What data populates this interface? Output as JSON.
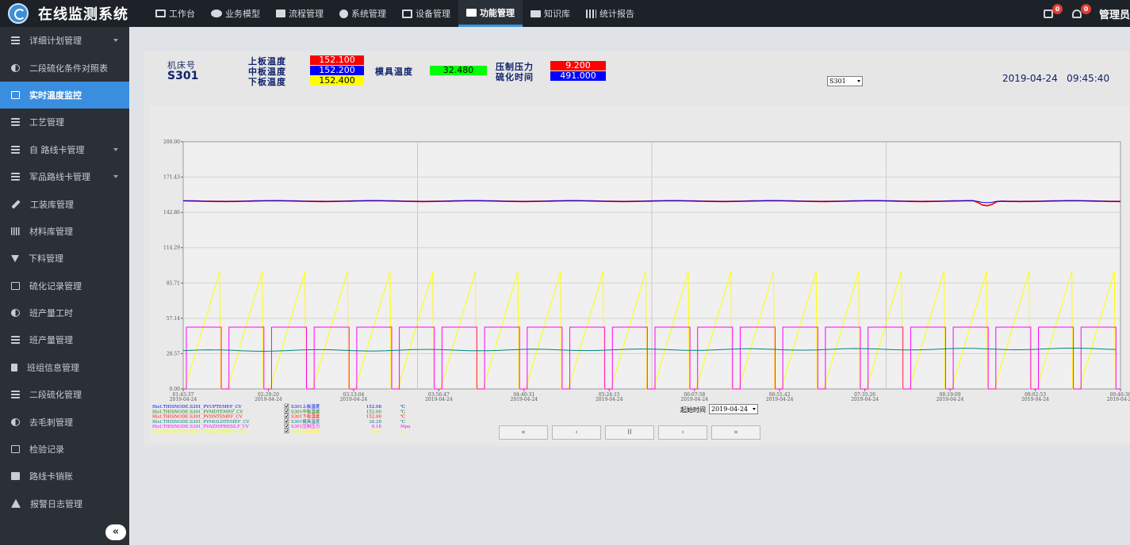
{
  "header": {
    "title": "在线监测系统",
    "nav": [
      {
        "label": "工作台",
        "icon": "monitor-icon"
      },
      {
        "label": "业务模型",
        "icon": "group-icon"
      },
      {
        "label": "流程管理",
        "icon": "sitemap-icon"
      },
      {
        "label": "系统管理",
        "icon": "gear-icon"
      },
      {
        "label": "设备管理",
        "icon": "device-icon"
      },
      {
        "label": "功能管理",
        "icon": "list-icon",
        "active": true
      },
      {
        "label": "知识库",
        "icon": "folder-icon"
      },
      {
        "label": "统计报告",
        "icon": "bar-chart-icon"
      }
    ],
    "task_badge": "0",
    "notice_badge": "0",
    "user": "管理员"
  },
  "sidebar": {
    "items": [
      {
        "label": "详细计划管理",
        "has_arrow": true
      },
      {
        "label": "二段硫化条件对照表"
      },
      {
        "label": "实时温度监控",
        "active": true
      },
      {
        "label": "工艺管理"
      },
      {
        "label": "自  路线卡管理",
        "has_arrow": true
      },
      {
        "label": "军品路线卡管理",
        "has_arrow": true
      },
      {
        "label": "工装库管理"
      },
      {
        "label": "材料库管理"
      },
      {
        "label": "下料管理"
      },
      {
        "label": "硫化记录管理"
      },
      {
        "label": "班产量工时"
      },
      {
        "label": "班产量管理"
      },
      {
        "label": "班组信息管理"
      },
      {
        "label": "二段硫化管理"
      },
      {
        "label": "去毛刺管理"
      },
      {
        "label": "检验记录"
      },
      {
        "label": "路线卡销账"
      },
      {
        "label": "报警日志管理"
      }
    ],
    "collapse_label": "«"
  },
  "monitor": {
    "machine_label": "机床号",
    "machine_id": "S301",
    "upper_temp_label": "上板温度",
    "upper_temp": "152.100",
    "middle_temp_label": "中板温度",
    "middle_temp": "152.200",
    "lower_temp_label": "下板温度",
    "lower_temp": "152.400",
    "mold_temp_label": "模具温度",
    "mold_temp": "32.480",
    "pressure_label": "压制压力",
    "pressure": "9.200",
    "cure_time_label": "硫化时间",
    "cure_time": "491.000",
    "machine_select": "S301",
    "datetime": "2019-04-24   09:45:40",
    "start_time_label": "起始时间",
    "start_date": "2019-04-24",
    "colors": {
      "upper": "#ff0000",
      "middle": "#0000ff",
      "lower": "#ffff00",
      "mold": "#00ff00",
      "pressure": "#ff0000",
      "cure": "#0000ff"
    }
  },
  "controls": [
    "«",
    "‹",
    "II",
    "›",
    "»"
  ],
  "chart_data": {
    "type": "line",
    "ylim": [
      0,
      200
    ],
    "y_ticks": [
      "200.00",
      "171.43",
      "142.86",
      "114.29",
      "85.71",
      "57.14",
      "28.57",
      "0.00"
    ],
    "x_ticks": [
      {
        "time": "01:45:37",
        "date": "2019-04-24"
      },
      {
        "time": "02:29:20",
        "date": "2019-04-24"
      },
      {
        "time": "03:13:04",
        "date": "2019-04-24"
      },
      {
        "time": "03:56:47",
        "date": "2019-04-24"
      },
      {
        "time": "04:40:31",
        "date": "2019-04-24"
      },
      {
        "time": "05:24:15",
        "date": "2019-04-24"
      },
      {
        "time": "06:07:58",
        "date": "2019-04-24"
      },
      {
        "time": "06:51:42",
        "date": "2019-04-24"
      },
      {
        "time": "07:35:26",
        "date": "2019-04-24"
      },
      {
        "time": "08:19:09",
        "date": "2019-04-24"
      },
      {
        "time": "09:02:53",
        "date": "2019-04-24"
      },
      {
        "time": "09:46:36",
        "date": "2019-04-24"
      }
    ],
    "series": [
      {
        "tag": "Hist.THISNODE.S301_PVUPTEMP.F_CV",
        "name": "S301上板温度",
        "value": "152.08",
        "unit": "℃",
        "color": "#ff0000",
        "level": 152
      },
      {
        "tag": "Hist.THISNODE.S301_PVMDTEMP.F_CV",
        "name": "S301中板温度",
        "value": "152.00",
        "unit": "℃",
        "color": "#0000ff",
        "level": 152
      },
      {
        "tag": "Hist.THISNODE.S301_PVDNTEMP.F_CV",
        "name": "S301下板温度",
        "value": "152.00",
        "unit": "℃",
        "color": "#ff0000",
        "level": 152
      },
      {
        "tag": "Hist.THISNODE.S301_PVMOLDTEMP.F_CV",
        "name": "S301模具温度",
        "value": "30.28",
        "unit": "℃",
        "color": "#008080",
        "level": 31
      },
      {
        "tag": "Hist.THISNODE.S301_PVAZHIPRESS.F_CV",
        "name": "S301压制压力",
        "value": "0.18",
        "unit": "Mpa",
        "color": "#ff00ff",
        "level": 50
      },
      {
        "tag": "Hist.THISNODE.S301_PVAZHITIME.F_CV",
        "name": "S301压制时间",
        "value": "0.00",
        "unit": "s",
        "color": "#ffff00",
        "level": 95
      }
    ]
  }
}
